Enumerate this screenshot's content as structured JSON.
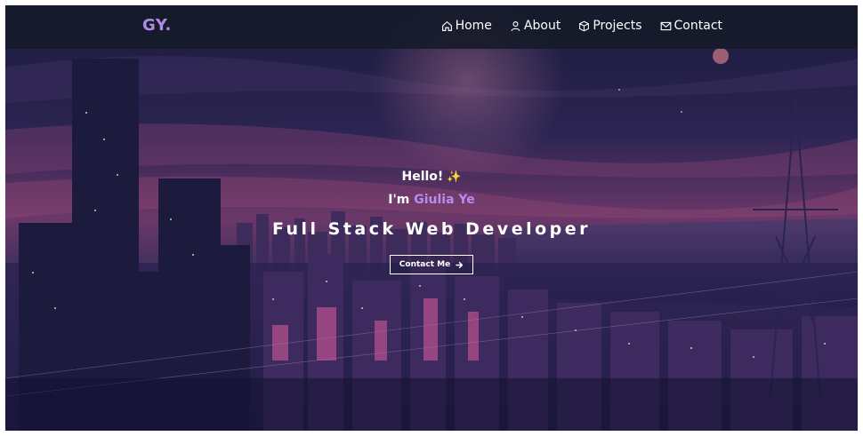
{
  "brand": {
    "text": "GY",
    "dot": "."
  },
  "nav": {
    "items": [
      {
        "label": "Home",
        "icon": "home-icon"
      },
      {
        "label": "About",
        "icon": "user-icon"
      },
      {
        "label": "Projects",
        "icon": "box-icon"
      },
      {
        "label": "Contact",
        "icon": "mail-icon"
      }
    ]
  },
  "hero": {
    "greeting": "Hello!",
    "greeting_emoji": "✨",
    "intro_prefix": "I'm",
    "name": "Giulia Ye",
    "role": "Full Stack Web Developer",
    "cta_label": "Contact Me",
    "cta_icon": "arrow-right-icon"
  },
  "colors": {
    "accent": "#b089e6",
    "navbar_bg": "#161b2a",
    "text": "#ffffff"
  }
}
